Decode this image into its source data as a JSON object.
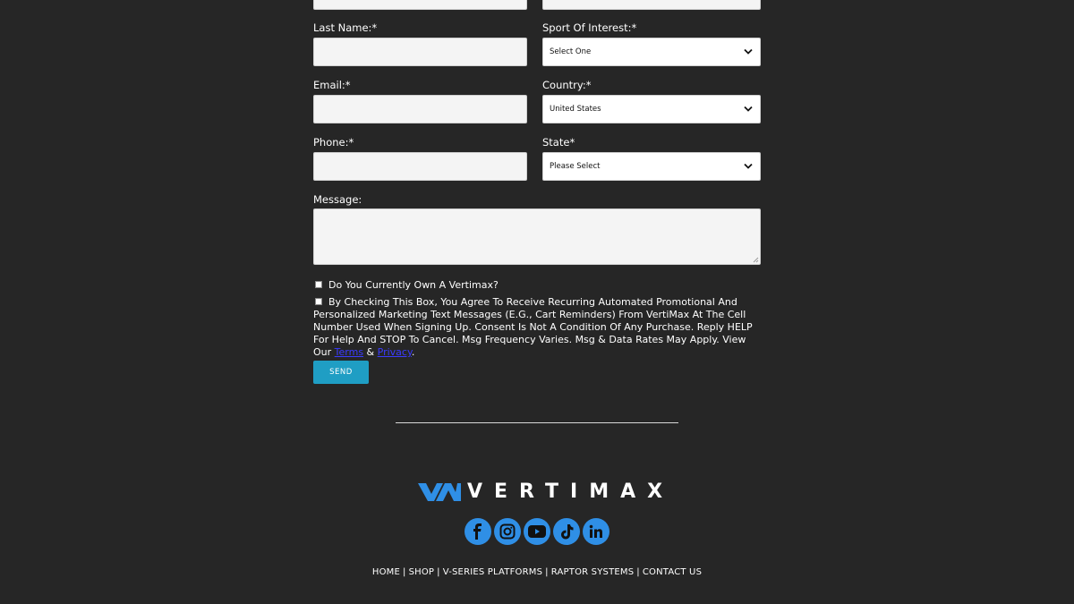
{
  "form": {
    "fields": {
      "last_name_label": "Last Name:*",
      "sport_label": "Sport Of Interest:*",
      "sport_value": "Select One",
      "email_label": "Email:*",
      "country_label": "Country:*",
      "country_value": "United States",
      "phone_label": "Phone:*",
      "state_label": "State*",
      "state_value": "Please Select",
      "message_label": "Message:"
    },
    "own_vertimax_label": "Do You Currently Own A Vertimax?",
    "consent_text": "By Checking This Box, You Agree To Receive Recurring Automated Promotional And Personalized Marketing Text Messages (E.G., Cart Reminders) From VertiMax At The Cell Number Used When Signing Up. Consent Is Not A Condition Of Any Purchase. Reply HELP For Help And STOP To Cancel. Msg Frequency Varies. Msg & Data Rates May Apply.  View Our ",
    "terms_link": "Terms",
    "amp": " & ",
    "privacy_link": "Privacy",
    "period": ".",
    "send_label": "SEND"
  },
  "footer": {
    "logo_text": "VERTIMAX",
    "social": [
      "facebook-icon",
      "instagram-icon",
      "youtube-icon",
      "tiktok-icon",
      "linkedin-icon"
    ],
    "nav": [
      "HOME",
      "SHOP",
      "V-SERIES PLATFORMS",
      "RAPTOR SYSTEMS",
      "CONTACT US"
    ],
    "nav_separator": "|"
  },
  "colors": {
    "background": "#262626",
    "accent": "#1f9ec4",
    "social": "#2f8fe6",
    "logo_mark": "#2f8fe6"
  }
}
